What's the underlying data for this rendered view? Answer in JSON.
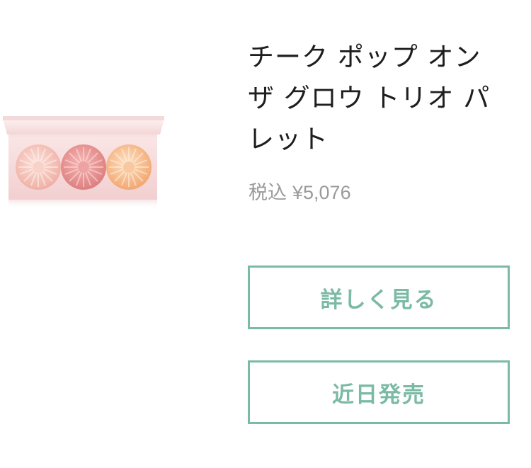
{
  "product": {
    "title": "チーク ポップ オン ザ グロウ トリオ パレット",
    "price_tax_label": "税込",
    "price_value": "¥5,076",
    "image_icon": "blush-palette-image",
    "colors": {
      "accent": "#7bbaa5",
      "palette_case": "#f6d8d8",
      "shade_1": "#f3bcb3",
      "shade_2": "#e79391",
      "shade_3": "#f6b984"
    }
  },
  "actions": {
    "details_label": "詳しく見る",
    "coming_soon_label": "近日発売"
  }
}
